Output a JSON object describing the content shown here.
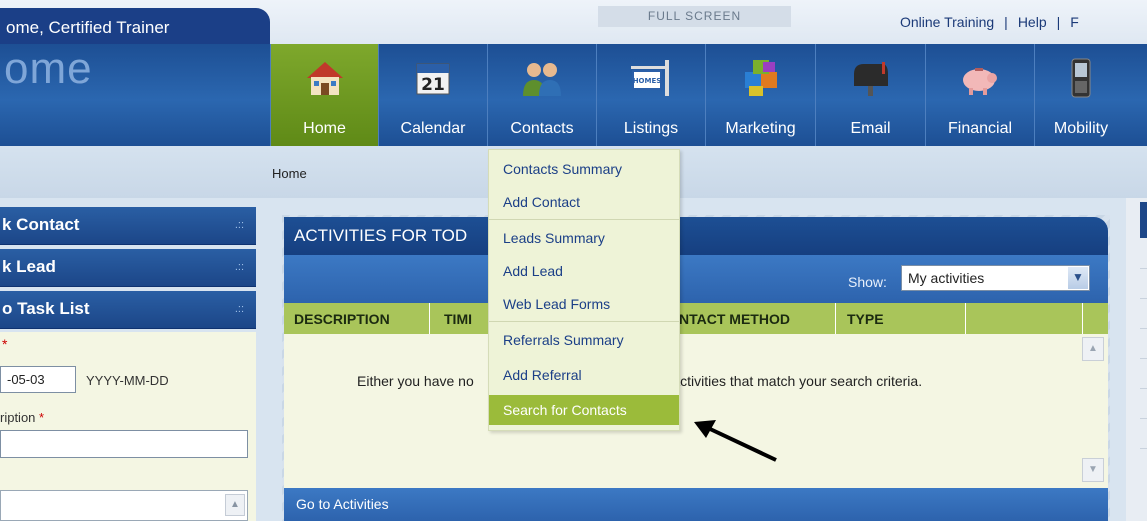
{
  "top": {
    "welcome": "ome, Certified Trainer",
    "fullscreen": "FULL SCREEN",
    "links": [
      "Online Training",
      "Help",
      "F"
    ]
  },
  "brand": "ome",
  "nav": [
    {
      "label": "Home",
      "icon": "house-icon",
      "active": true
    },
    {
      "label": "Calendar",
      "icon": "calendar-icon",
      "day": "21"
    },
    {
      "label": "Contacts",
      "icon": "people-icon"
    },
    {
      "label": "Listings",
      "icon": "homes-sign-icon",
      "sign": "HOMES"
    },
    {
      "label": "Marketing",
      "icon": "puzzle-icon"
    },
    {
      "label": "Email",
      "icon": "mailbox-icon"
    },
    {
      "label": "Financial",
      "icon": "piggy-bank-icon"
    },
    {
      "label": "Mobility",
      "icon": "phone-icon"
    }
  ],
  "breadcrumb": "Home",
  "sidebar": {
    "items": [
      {
        "label": "k Contact"
      },
      {
        "label": "k Lead"
      },
      {
        "label": "o Task List"
      }
    ],
    "grip": ".::",
    "star": "*",
    "date_value": "-05-03",
    "date_format": "YYYY-MM-DD",
    "description_label": "ription"
  },
  "activities": {
    "title": "ACTIVITIES FOR TOD",
    "show_label": "Show:",
    "show_value": "My activities",
    "columns": [
      "DESCRIPTION",
      "TIMI",
      "NTACT METHOD",
      "TYPE"
    ],
    "empty_left": "Either you have no",
    "empty_right": "are no activities that match your search criteria.",
    "footer": "Go to Activities"
  },
  "contacts_menu": [
    "Contacts Summary",
    "Add Contact",
    "Leads Summary",
    "Add Lead",
    "Web Lead Forms",
    "Referrals Summary",
    "Add Referral",
    "Search for Contacts"
  ],
  "colors": {
    "header_blue": "#1d4f94",
    "active_green": "#6f9a22",
    "menu_highlight": "#9bbb3a",
    "table_header": "#a9c55a"
  }
}
